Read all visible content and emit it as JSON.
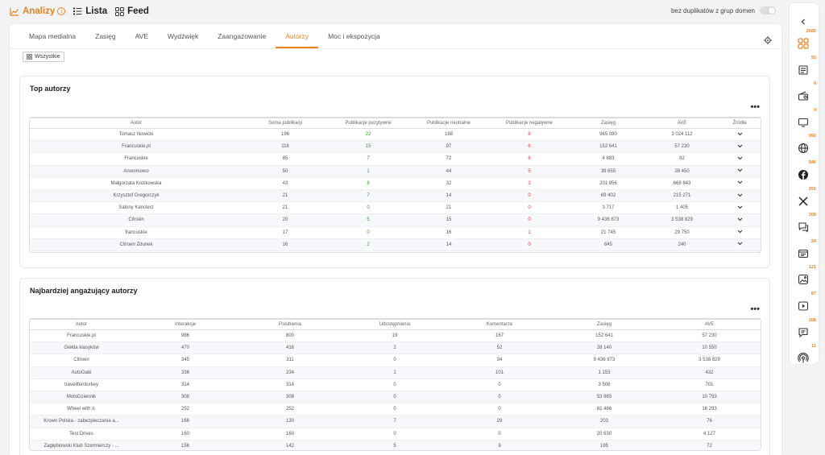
{
  "header": {
    "views": [
      {
        "label": "Analizy",
        "icon": "line-chart-icon",
        "active": true
      },
      {
        "label": "Lista",
        "icon": "list-icon",
        "active": false
      },
      {
        "label": "Feed",
        "icon": "feed-grid-icon",
        "active": false
      }
    ],
    "duplicates_label": "bez duplikatów z grup domen"
  },
  "tabs": [
    "Mapa medialna",
    "Zasięg",
    "AVE",
    "Wydźwięk",
    "Zaangażowanie",
    "Autorzy",
    "Moc i ekspozycja"
  ],
  "active_tab": "Autorzy",
  "filter_label": "Wszystkie",
  "top_authors": {
    "title": "Top autorzy",
    "columns": [
      "Autor",
      "Suma publikacji",
      "Publikacje pozytywne",
      "Publikacje neutralne",
      "Publikacje negatywne",
      "Zasięg",
      "AVE",
      "Źródła"
    ],
    "rows": [
      [
        "Tomasz Nowicki",
        "196",
        "22",
        "168",
        "6",
        "965 080",
        "3 024 112"
      ],
      [
        "Francuskie.pl",
        "118",
        "15",
        "97",
        "6",
        "152 641",
        "57 230"
      ],
      [
        "Francuskie",
        "85",
        "7",
        "72",
        "6",
        "4 883",
        "82"
      ],
      [
        "Anonimowo",
        "50",
        "1",
        "44",
        "5",
        "39 655",
        "28 450"
      ],
      [
        "Małgorzata Kozikowska",
        "43",
        "8",
        "32",
        "3",
        "201 956",
        "668 843"
      ],
      [
        "Krzysztof Gregorczyk",
        "21",
        "7",
        "14",
        "0",
        "69 402",
        "215 271"
      ],
      [
        "Salony Kanclerz",
        "21",
        "0",
        "21",
        "0",
        "3 717",
        "1 405"
      ],
      [
        "Citroën",
        "20",
        "5",
        "15",
        "0",
        "9 436 873",
        "3 538 829"
      ],
      [
        "francuskie",
        "17",
        "0",
        "16",
        "1",
        "21 745",
        "29 750"
      ],
      [
        "Citroen Zdunek",
        "16",
        "2",
        "14",
        "0",
        "645",
        "240"
      ]
    ]
  },
  "engaging_authors": {
    "title": "Najbardziej angażujący autorzy",
    "columns": [
      "Autor",
      "Interakcje",
      "Polubienia",
      "Udostępnienia",
      "Komentarze",
      "Zasięg",
      "AVE"
    ],
    "rows": [
      [
        "Francuskie.pl",
        "986",
        "800",
        "19",
        "167",
        "152 641",
        "57 230"
      ],
      [
        "Giełda klasyków",
        "470",
        "416",
        "2",
        "52",
        "28 140",
        "10 550"
      ],
      [
        "Citroen",
        "345",
        "311",
        "0",
        "34",
        "9 436 873",
        "3 538 829"
      ],
      [
        "AutoGabi",
        "336",
        "234",
        "1",
        "101",
        "1 153",
        "432"
      ],
      [
        "travellfeinturkey",
        "314",
        "314",
        "0",
        "0",
        "3 506",
        "701"
      ],
      [
        "MotoDziennik",
        "308",
        "308",
        "0",
        "0",
        "53 965",
        "10 793"
      ],
      [
        "Wheel with it.",
        "252",
        "252",
        "0",
        "0",
        "81 466",
        "16 293"
      ],
      [
        "Krown Polska - zabezpieczania a...",
        "166",
        "130",
        "7",
        "29",
        "203",
        "76"
      ],
      [
        "Test Drives",
        "160",
        "160",
        "0",
        "0",
        "20 630",
        "4 127"
      ],
      [
        "Zagłębiowski Klub Szermierczy - ...",
        "156",
        "142",
        "5",
        "9",
        "195",
        "72"
      ]
    ]
  },
  "sidebar": [
    {
      "count": "2582",
      "icon": "all-sources-icon"
    },
    {
      "count": "93",
      "icon": "newspaper-icon"
    },
    {
      "count": "0",
      "icon": "radio-icon"
    },
    {
      "count": "0",
      "icon": "tv-icon"
    },
    {
      "count": "992",
      "icon": "web-globe-icon"
    },
    {
      "count": "546",
      "icon": "facebook-icon"
    },
    {
      "count": "291",
      "icon": "x-twitter-icon"
    },
    {
      "count": "209",
      "icon": "forum-icon"
    },
    {
      "count": "24",
      "icon": "blog-icon"
    },
    {
      "count": "121",
      "icon": "instagram-icon"
    },
    {
      "count": "87",
      "icon": "youtube-icon"
    },
    {
      "count": "208",
      "icon": "comments-icon"
    },
    {
      "count": "11",
      "icon": "podcast-icon"
    }
  ]
}
